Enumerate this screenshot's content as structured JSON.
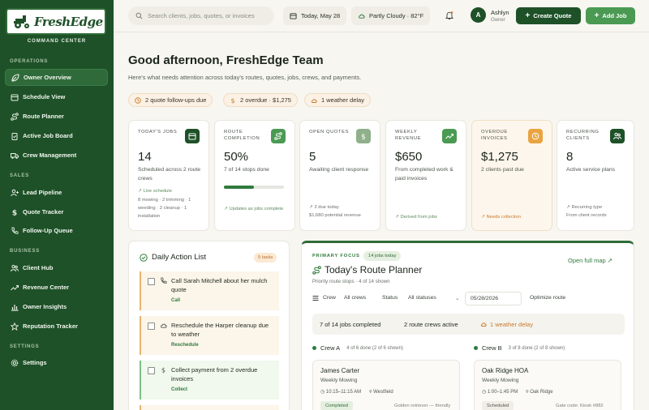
{
  "brand": {
    "name": "FreshEdge",
    "tagline": "LANDSCAPING CO.",
    "subtitle": "COMMAND CENTER"
  },
  "sidebar": {
    "sections": [
      {
        "label": "OPERATIONS",
        "items": [
          "Owner Overview",
          "Schedule View",
          "Route Planner",
          "Active Job Board",
          "Crew Management"
        ]
      },
      {
        "label": "SALES",
        "items": [
          "Lead Pipeline",
          "Quote Tracker",
          "Follow-Up Queue"
        ]
      },
      {
        "label": "BUSINESS",
        "items": [
          "Client Hub",
          "Revenue Center",
          "Owner Insights",
          "Reputation Tracker"
        ]
      },
      {
        "label": "SETTINGS",
        "items": [
          "Settings"
        ]
      }
    ],
    "active": "Owner Overview"
  },
  "topbar": {
    "search_placeholder": "Search clients, jobs, quotes, or invoices",
    "date": "Today, May 28",
    "weather": "Partly Cloudy · 82°F",
    "user_initial": "A",
    "user_name": "Ashlyn",
    "user_role": "Owner",
    "create_quote": "Create Quote",
    "add_job": "Add Job"
  },
  "header": {
    "greeting": "Good afternoon, FreshEdge Team",
    "subtitle": "Here's what needs attention across today's routes, quotes, jobs, crews, and payments.",
    "alerts": [
      "2 quote follow-ups due",
      "2 overdue · $1,275",
      "1 weather delay"
    ]
  },
  "cards": [
    {
      "label": "TODAY'S JOBS",
      "value": "14",
      "desc": "Scheduled across 2 route crews",
      "foot": "↗ Live schedule",
      "extra": "8 mowing · 2 trimming · 1 weeding · 2 cleanup · 1 installation",
      "icon": "calendar-icon",
      "color": "#1e5128"
    },
    {
      "label": "ROUTE COMPLETION",
      "value": "50%",
      "desc": "7 of 14 stops done",
      "foot": "↗ Updates as jobs complete",
      "progress": 0.5,
      "icon": "route-icon",
      "color": "#4a9a53"
    },
    {
      "label": "OPEN QUOTES",
      "value": "5",
      "desc": "Awaiting client response",
      "extra": "↗ 2 due today\n$1,680 potential revenue",
      "icon": "dollar-icon",
      "color": "#8fb08a"
    },
    {
      "label": "WEEKLY REVENUE",
      "value": "$650",
      "desc": "From completed work & paid invoices",
      "foot": "↗ Derived from jobs",
      "icon": "trend-icon",
      "color": "#4a9a53"
    },
    {
      "label": "OVERDUE INVOICES",
      "value": "$1,275",
      "desc": "2 clients past due",
      "foot": "↗ Needs collection",
      "icon": "clock-icon",
      "color": "#e9a441"
    },
    {
      "label": "RECURRING CLIENTS",
      "value": "8",
      "desc": "Active service plans",
      "extra": "↗ Recurring type\nFrom client records",
      "icon": "users-icon",
      "color": "#1e5128"
    }
  ],
  "actions": {
    "title": "Daily Action List",
    "badge": "5 tasks",
    "tasks": [
      {
        "text": "Call Sarah Mitchell about her mulch quote",
        "tag": "Call",
        "icon": "phone-icon"
      },
      {
        "text": "Reschedule the Harper cleanup due to weather",
        "tag": "Reschedule",
        "icon": "cloud-icon"
      },
      {
        "text": "Collect payment from 2 overdue invoices",
        "tag": "Collect",
        "icon": "dollar-icon"
      }
    ]
  },
  "planner": {
    "focus": "PRIMARY FOCUS",
    "badge": "14 jobs today",
    "title": "Today's Route Planner",
    "subtitle": "Priority route stops · 4 of 14 shown",
    "full_map": "Open full map ↗",
    "filters": {
      "crew_label": "Crew",
      "crew_value": "All crews",
      "status_label": "Status",
      "status_value": "All statuses",
      "date": "05/28/2026",
      "optimize": "Optimize route"
    },
    "stats": [
      "7 of 14 jobs completed",
      "2 route crews active",
      "1 weather delay"
    ],
    "crews": [
      {
        "name": "Crew A",
        "meta": "4 of 6 done (2 of 6 shown)",
        "job": {
          "client": "James Carter",
          "type": "Weekly Mowing",
          "time": "10:15–11:15 AM",
          "place": "Westfield",
          "status": "Completed",
          "note": "Golden retriever — friendly"
        }
      },
      {
        "name": "Crew B",
        "meta": "3 of 8 done (2 of 8 shown)",
        "job": {
          "client": "Oak Ridge HOA",
          "type": "Weekly Mowing",
          "time": "1:00–1:45 PM",
          "place": "Oak Ridge",
          "status": "Scheduled",
          "note": "Gate code: Kiosk #882"
        }
      }
    ]
  }
}
